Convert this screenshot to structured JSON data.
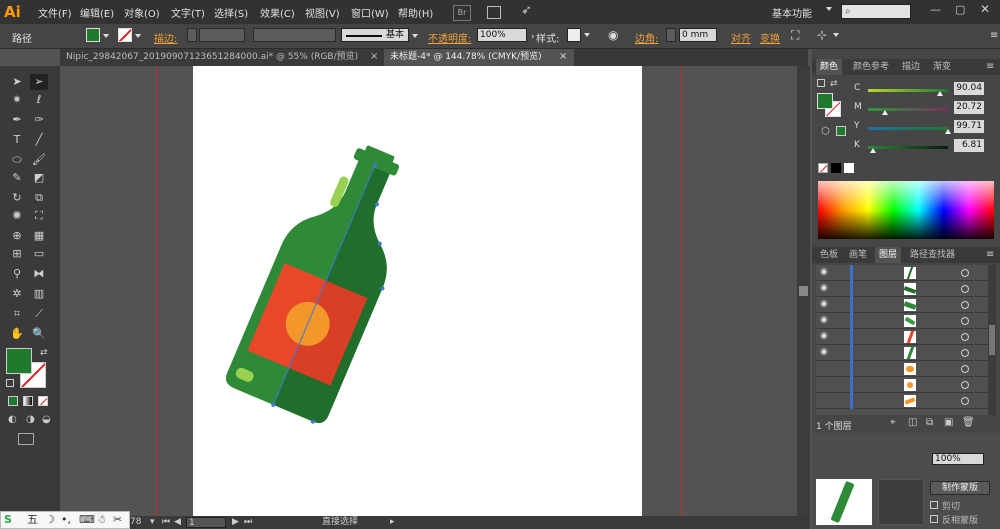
{
  "app": {
    "logo": "Ai"
  },
  "menu": [
    "文件(F)",
    "编辑(E)",
    "对象(O)",
    "文字(T)",
    "选择(S)",
    "效果(C)",
    "视图(V)",
    "窗口(W)",
    "帮助(H)"
  ],
  "workspace": {
    "label": "基本功能"
  },
  "control_bar": {
    "path_label": "路径",
    "stroke_label": "描边:",
    "stroke_style": "基本",
    "opacity_label": "不透明度:",
    "opacity_value": "100%",
    "style_label": "样式:",
    "corner_label": "边角:",
    "corner_value": "0 mm",
    "align_label": "对齐",
    "transform_label": "变换"
  },
  "doc_tabs": [
    {
      "label": "Nipic_29842067_20190907123651284000.ai* @ 55% (RGB/预览)",
      "active": false
    },
    {
      "label": "未标题-4* @ 144.78% (CMYK/预览)",
      "active": true
    }
  ],
  "status": {
    "zoom_partial": "78",
    "page": "1",
    "tool": "直接选择"
  },
  "color_panel": {
    "tabs": [
      "颜色",
      "颜色参考",
      "描边",
      "渐变"
    ],
    "channels": [
      {
        "label": "C",
        "value": "90.04",
        "pct": 0.9004
      },
      {
        "label": "M",
        "value": "20.72",
        "pct": 0.2072
      },
      {
        "label": "Y",
        "value": "99.71",
        "pct": 0.9971
      },
      {
        "label": "K",
        "value": "6.81",
        "pct": 0.0681
      }
    ],
    "fill_color": "#1f7a2e"
  },
  "layers_panel": {
    "tabs": [
      "色板",
      "画笔",
      "图层",
      "路径查找器"
    ],
    "footer": "1 个图层"
  },
  "lower_panel": {
    "mask_button": "制作蒙版",
    "clip_label": "剪切",
    "invert_label": "反相蒙版",
    "opacity_value": "100%"
  },
  "taskbar": {
    "ime": "五"
  },
  "colors": {
    "bottle_dark": "#1f6e2b",
    "bottle_light": "#2f8a37",
    "label": "#e8472a",
    "sun": "#f3972b",
    "highlight": "#9ad04f",
    "selection": "#3f76d6"
  }
}
